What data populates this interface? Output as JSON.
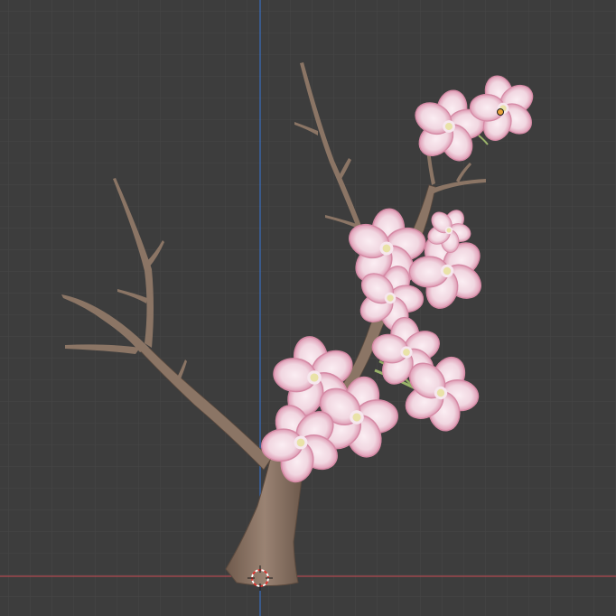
{
  "viewport": {
    "background": "#3d3d3d",
    "grid_minor_color": "#454545",
    "grid_major_color": "#4a4a4a",
    "axis_x_color": "#b0484f",
    "axis_z_color": "#3a6fbe"
  },
  "scene": {
    "object_name": "cherry-blossom-branch",
    "bark_color": "#8b7565",
    "bark_shadow": "#6b574a",
    "petal_color": "#f3dde6",
    "petal_edge": "#d98aa7",
    "stamen_color": "#e9e2a8",
    "origin_color": "#e8a23a",
    "cursor_colors": [
      "#ffffff",
      "#e0342f"
    ]
  }
}
